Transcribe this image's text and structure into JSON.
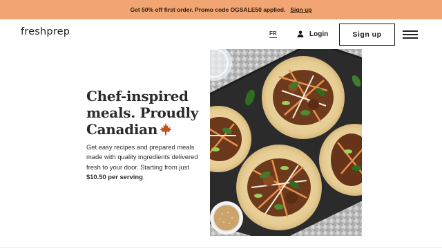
{
  "promo": {
    "text": "Get 50% off first order.  Promo code OGSALE50 applied.",
    "link": "Sign up"
  },
  "nav": {
    "logo": "freshprep",
    "lang": "FR",
    "login": "Login",
    "signup": "Sign up"
  },
  "hero": {
    "title_line1": "Chef-inspired",
    "title_line2": "meals. Proudly",
    "title_line3": "Canadian",
    "desc_prefix": "Get easy recipes and prepared meals made with quality ingredients delivered fresh to your door. Starting from just ",
    "desc_price": "$10.50 per serving",
    "desc_suffix": "."
  },
  "colors": {
    "promo_bg": "#f0a572",
    "maple": "#c8501e"
  },
  "icons": {
    "login": "user-icon",
    "menu": "hamburger-menu-icon",
    "maple": "maple-leaf-icon"
  }
}
